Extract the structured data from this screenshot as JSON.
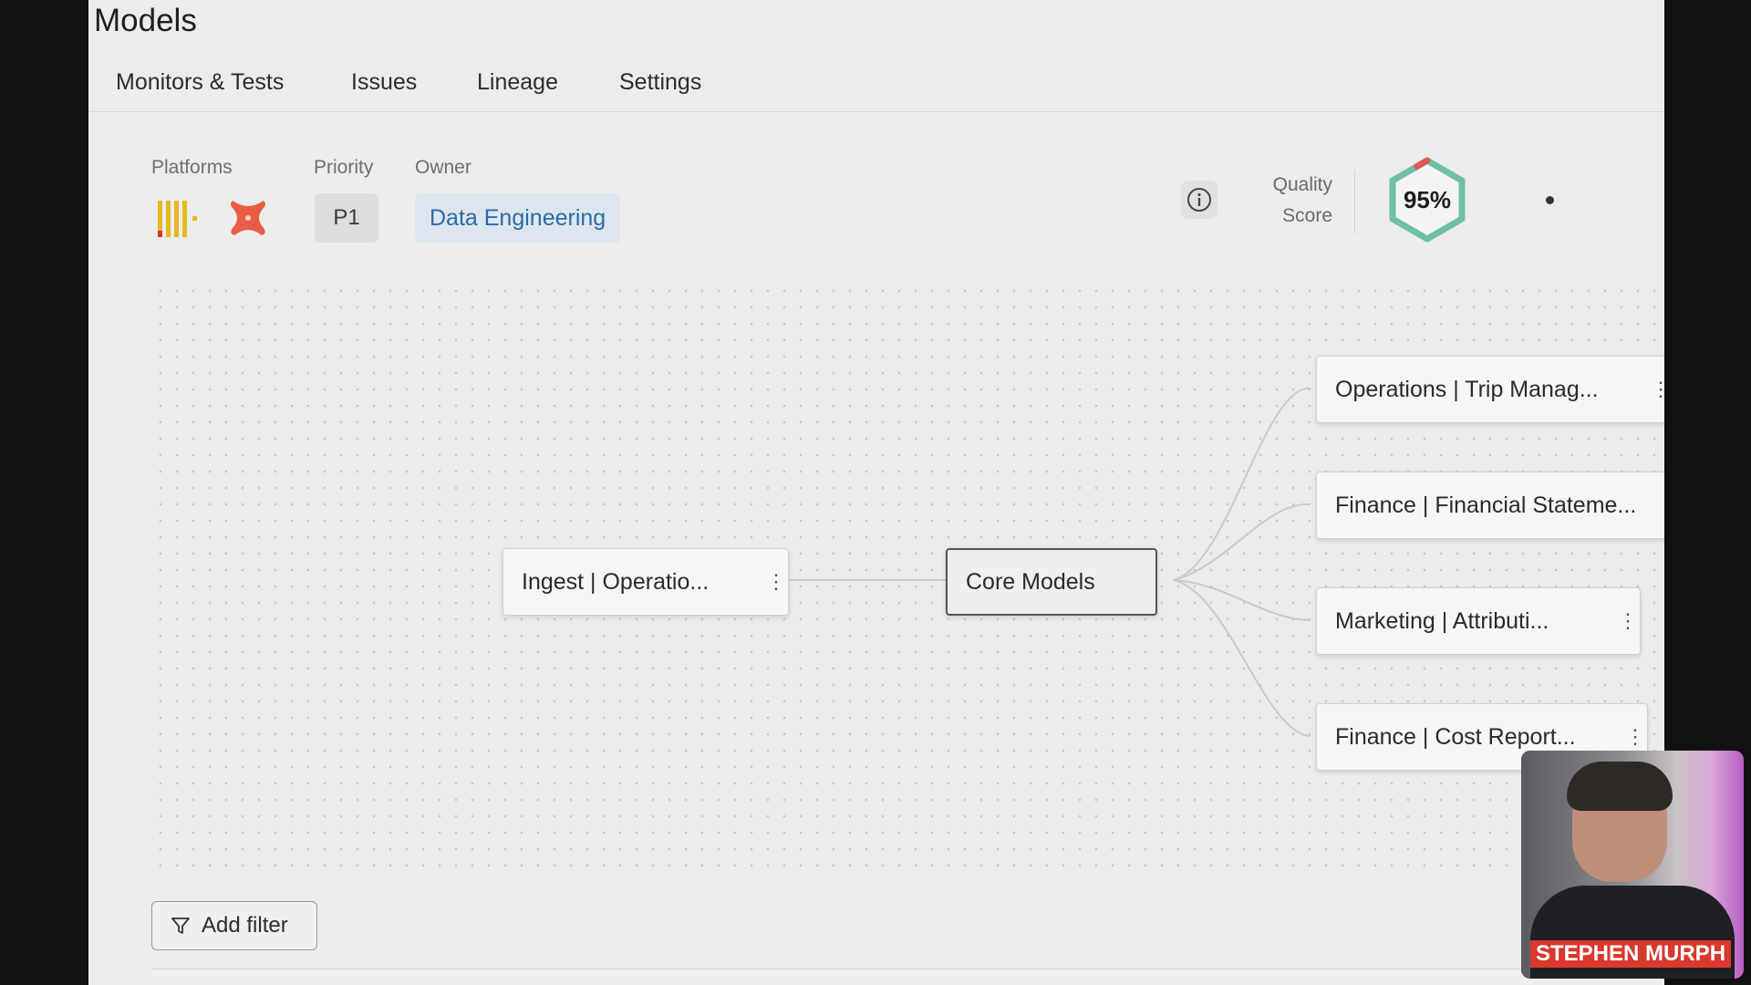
{
  "page": {
    "title": "Models"
  },
  "tabs": [
    {
      "label": "Monitors & Tests"
    },
    {
      "label": "Issues"
    },
    {
      "label": "Lineage"
    },
    {
      "label": "Settings"
    }
  ],
  "meta": {
    "platforms_label": "Platforms",
    "priority_label": "Priority",
    "priority_value": "P1",
    "owner_label": "Owner",
    "owner_value": "Data Engineering",
    "platform_icons": [
      "snowflake-bars-logo",
      "dbt-logo"
    ]
  },
  "quality": {
    "label_line1": "Quality",
    "label_line2": "Score",
    "value": "95%",
    "score": 0.95,
    "color": "#6dbfa5",
    "accent": "#e05a55"
  },
  "lineage": {
    "nodes": [
      {
        "label": "Ingest | Operatio..."
      },
      {
        "label": "Core Models"
      },
      {
        "label": "Operations | Trip Manag..."
      },
      {
        "label": "Finance | Financial Stateme..."
      },
      {
        "label": "Marketing | Attributi..."
      },
      {
        "label": "Finance | Cost Report..."
      }
    ]
  },
  "filter": {
    "label": "Add filter"
  },
  "webcam": {
    "name": "STEPHEN MURPH"
  }
}
